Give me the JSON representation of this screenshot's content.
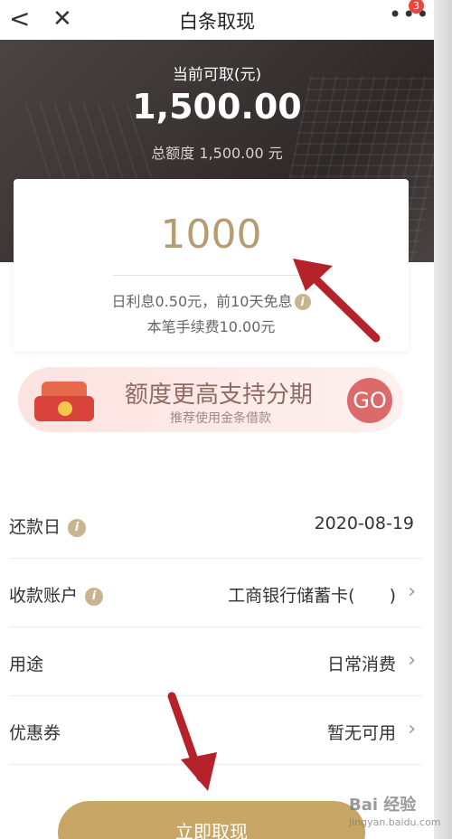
{
  "nav": {
    "back_icon": "chevron-left-icon",
    "close_icon": "close-icon",
    "title": "白条取现",
    "more_icon": "more-icon",
    "badge_count": "3"
  },
  "hero": {
    "label": "当前可取(元)",
    "amount": "1,500.00",
    "total": "总额度 1,500.00 元"
  },
  "withdraw": {
    "input_value": "1000",
    "interest": "日利息0.50元，前10天免息",
    "info_icon": "i",
    "fee": "本笔手续费10.00元"
  },
  "promo": {
    "main": "额度更高支持分期",
    "sub": "推荐使用金条借款",
    "go": "GO"
  },
  "rows": [
    {
      "label": "还款日",
      "value": "2020-08-19",
      "info": "i"
    },
    {
      "label": "收款账户",
      "value": "工商银行储蓄卡(　　)",
      "info": "i"
    },
    {
      "label": "用途",
      "value": "日常消费"
    },
    {
      "label": "优惠券",
      "value": "暂无可用"
    }
  ],
  "cta": {
    "label": "立即取现"
  },
  "colors": {
    "accent_gold": "#c8a766",
    "amount_gold": "#b59c72",
    "arrow_red": "#b6222a",
    "go_red": "#dc6a6a"
  },
  "watermark": {
    "text": "Bai 经验",
    "sub": "jingyan.baidu.com"
  }
}
